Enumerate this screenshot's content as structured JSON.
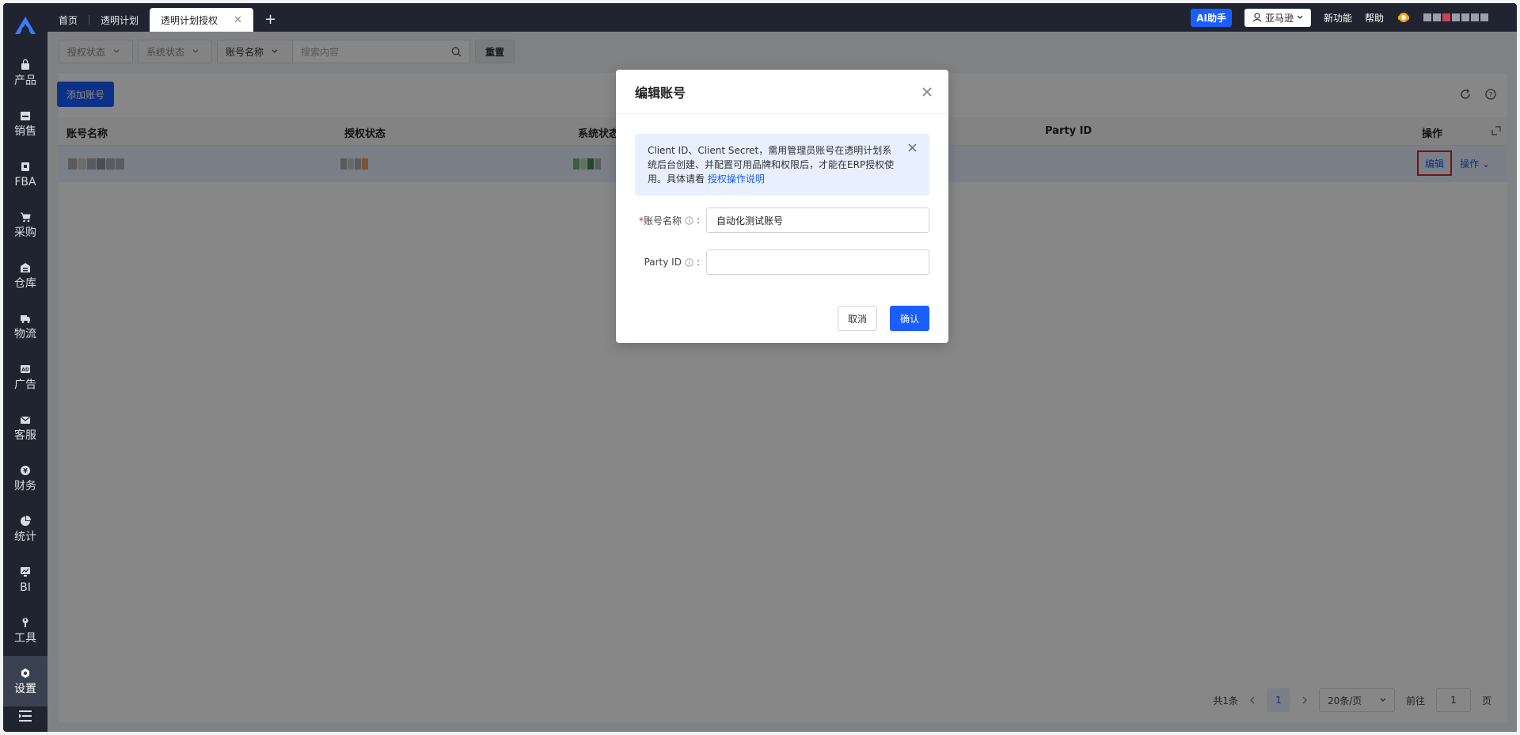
{
  "nav": {
    "items": [
      {
        "label": "产品",
        "icon": "bag-icon"
      },
      {
        "label": "销售",
        "icon": "shop-icon"
      },
      {
        "label": "FBA",
        "icon": "box-icon"
      },
      {
        "label": "采购",
        "icon": "cart-icon"
      },
      {
        "label": "仓库",
        "icon": "warehouse-icon"
      },
      {
        "label": "物流",
        "icon": "truck-icon"
      },
      {
        "label": "广告",
        "icon": "ad-icon"
      },
      {
        "label": "客服",
        "icon": "mail-icon"
      },
      {
        "label": "财务",
        "icon": "yuan-icon"
      },
      {
        "label": "统计",
        "icon": "pie-icon"
      },
      {
        "label": "BI",
        "icon": "chart-icon"
      },
      {
        "label": "工具",
        "icon": "wrench-icon"
      },
      {
        "label": "设置",
        "icon": "settings-icon"
      }
    ],
    "active": "设置"
  },
  "tabs": {
    "home": "首页",
    "plan": "透明计划",
    "auth": "透明计划授权",
    "close": "✕",
    "add": "+"
  },
  "topright": {
    "ai": "AI助手",
    "platform": "亚马逊",
    "new_feature": "新功能",
    "help": "帮助"
  },
  "filters": {
    "auth_status": "授权状态",
    "sys_status": "系统状态",
    "field": "账号名称",
    "search_placeholder": "搜索内容",
    "reset": "重置"
  },
  "toolbar": {
    "add_account": "添加账号"
  },
  "table": {
    "headers": {
      "account_name": "账号名称",
      "auth_status": "授权状态",
      "sys_status": "系统状态",
      "party_id": "Party ID",
      "ops": "操作"
    },
    "row": {
      "edit": "编辑",
      "more": "操作 ⌄"
    }
  },
  "pager": {
    "total": "共1条",
    "current": "1",
    "size": "20条/页",
    "goto": "前往",
    "goto_value": "1",
    "page_unit": "页"
  },
  "modal": {
    "title": "编辑账号",
    "notice_text": "Client ID、Client Secret，需用管理员账号在透明计划系统后台创建、并配置可用品牌和权限后，才能在ERP授权使用。具体请看 ",
    "notice_link": "授权操作说明",
    "fields": {
      "account_label": "账号名称",
      "account_value": "自动化测试账号",
      "party_label": "Party ID",
      "party_value": ""
    },
    "cancel": "取消",
    "confirm": "确认"
  }
}
